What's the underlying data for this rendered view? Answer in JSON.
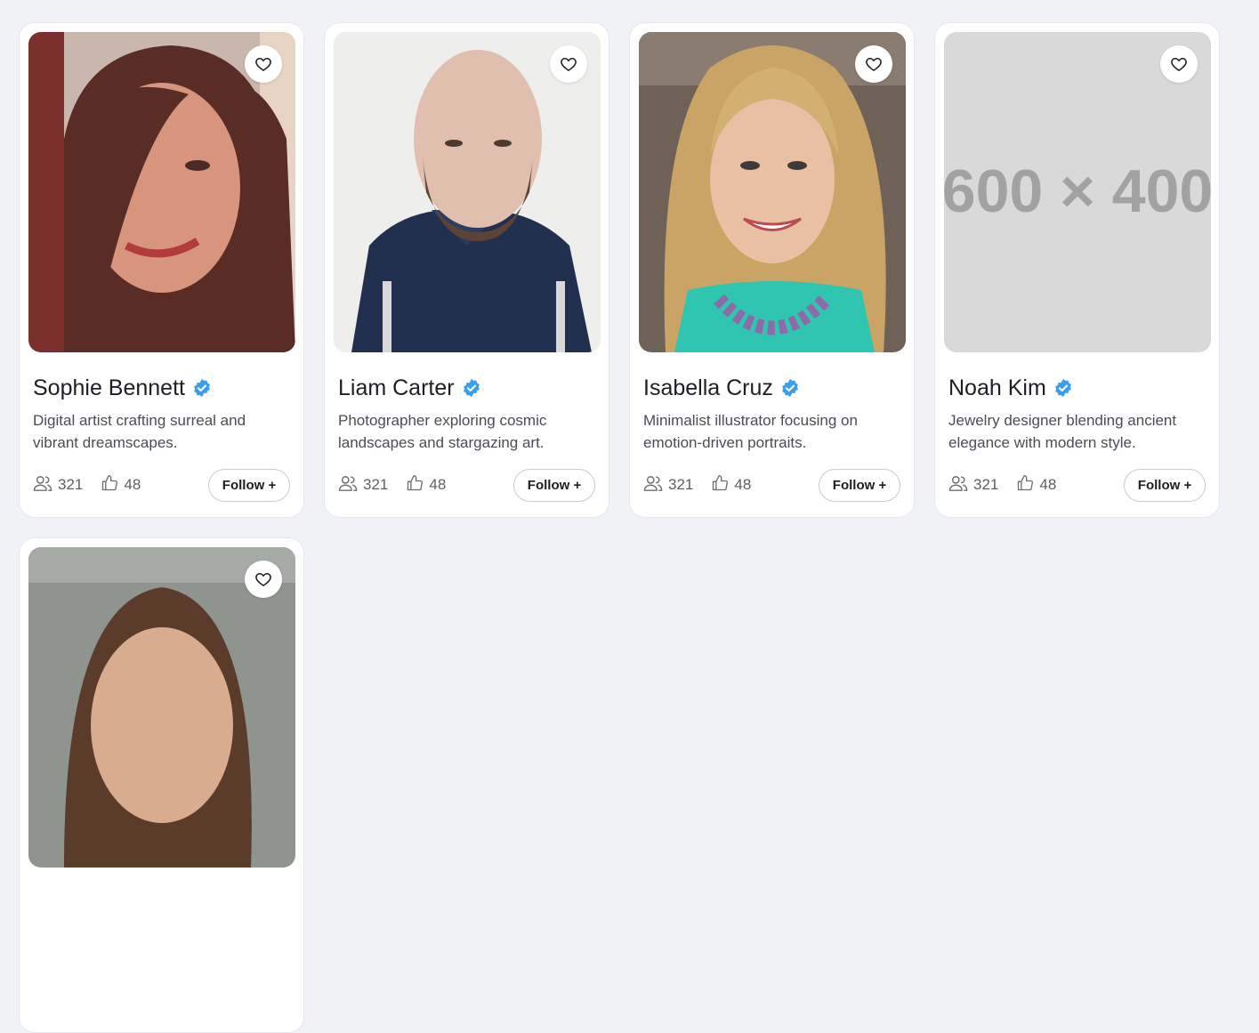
{
  "cards": [
    {
      "name": "Sophie Bennett",
      "bio": "Digital artist crafting surreal and vibrant dreamscapes.",
      "followers": "321",
      "likes": "48",
      "follow_label": "Follow +",
      "photo": "woman-dark-hair-portrait"
    },
    {
      "name": "Liam Carter",
      "bio": "Photographer exploring cosmic landscapes and stargazing art.",
      "followers": "321",
      "likes": "48",
      "follow_label": "Follow +",
      "photo": "bald-man-beard-navy-hoodie-portrait"
    },
    {
      "name": "Isabella Cruz",
      "bio": "Minimalist illustrator focusing on emotion-driven portraits.",
      "followers": "321",
      "likes": "48",
      "follow_label": "Follow +",
      "photo": "woman-blonde-hair-teal-top-portrait"
    },
    {
      "name": "Noah Kim",
      "bio": "Jewelry designer blending ancient elegance with modern style.",
      "followers": "321",
      "likes": "48",
      "follow_label": "Follow +",
      "photo": "placeholder-image",
      "placeholder_text": "600 × 400"
    },
    {
      "photo": "person-brown-hair-portrait"
    }
  ],
  "icons": {
    "favorite": "heart-outline-icon",
    "verified": "verified-badge-icon",
    "followers": "users-icon",
    "likes": "thumbs-up-icon"
  },
  "colors": {
    "background": "#f1f2f6",
    "card": "#ffffff",
    "verified_badge": "#3b9ded",
    "text_primary": "#1e1f24",
    "text_secondary": "#4a4d55"
  }
}
